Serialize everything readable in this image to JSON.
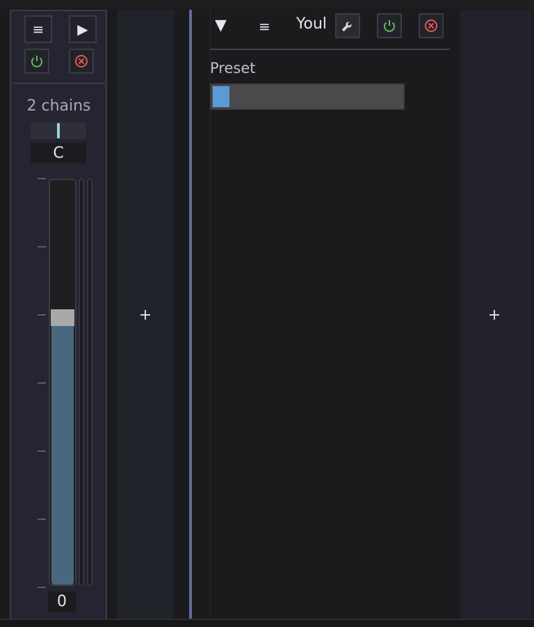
{
  "rack": {
    "menu_label": "≡",
    "play_label": "▶",
    "power_icon": "power-icon",
    "close_icon": "close-icon",
    "chains_label": "2 chains",
    "pan_value": "C",
    "volume_value": "0",
    "volume_level": 0.68,
    "colors": {
      "fill": "#496880",
      "handle": "#a9a9a9",
      "pan_marker": "#9fcde8"
    }
  },
  "chain_list": {
    "add_label": "+"
  },
  "device": {
    "collapse_label": "▼",
    "menu_label": "≡",
    "title": "Youl",
    "wrench_icon": "wrench-icon",
    "power_icon": "power-icon",
    "close_icon": "close-icon",
    "preset_label": "Preset",
    "preset_level": 0.05,
    "colors": {
      "preset_fill": "#5b9bd5",
      "power": "#5fb85f",
      "close": "#e05555"
    }
  },
  "right_panel": {
    "add_label": "+"
  }
}
